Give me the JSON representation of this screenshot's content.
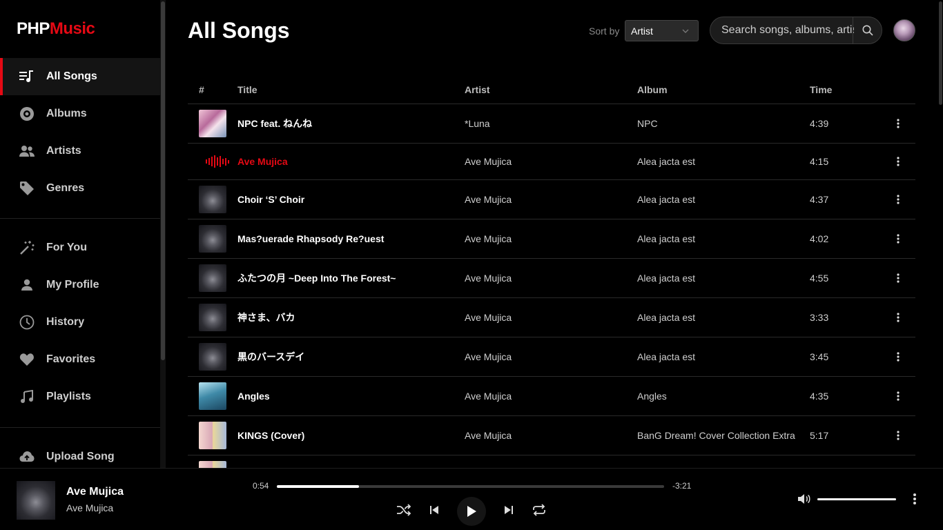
{
  "logo": {
    "part1": "PHP",
    "part2": "Music"
  },
  "sidebar": {
    "group1": [
      {
        "label": "All Songs",
        "icon": "song-list-icon",
        "active": true
      },
      {
        "label": "Albums",
        "icon": "disc-icon"
      },
      {
        "label": "Artists",
        "icon": "users-icon"
      },
      {
        "label": "Genres",
        "icon": "tag-icon"
      }
    ],
    "group2": [
      {
        "label": "For You",
        "icon": "magic-wand-icon"
      },
      {
        "label": "My Profile",
        "icon": "user-icon"
      },
      {
        "label": "History",
        "icon": "clock-icon"
      },
      {
        "label": "Favorites",
        "icon": "heart-icon"
      },
      {
        "label": "Playlists",
        "icon": "music-note-icon"
      }
    ],
    "group3": [
      {
        "label": "Upload Song",
        "icon": "cloud-upload-icon"
      }
    ]
  },
  "header": {
    "title": "All Songs",
    "sort_label": "Sort by",
    "sort_value": "Artist",
    "search_placeholder": "Search songs, albums, artists"
  },
  "table": {
    "headers": {
      "num": "#",
      "title": "Title",
      "artist": "Artist",
      "album": "Album",
      "time": "Time"
    },
    "rows": [
      {
        "title": "NPC feat. ねんね",
        "artist": "*Luna",
        "album": "NPC",
        "time": "4:39",
        "art": "npc"
      },
      {
        "title": "Ave Mujica",
        "artist": "Ave Mujica",
        "album": "Alea jacta est",
        "time": "4:15",
        "art": "ave",
        "playing": true
      },
      {
        "title": "Choir ‘S’ Choir",
        "artist": "Ave Mujica",
        "album": "Alea jacta est",
        "time": "4:37",
        "art": "ave"
      },
      {
        "title": "Mas?uerade Rhapsody Re?uest",
        "artist": "Ave Mujica",
        "album": "Alea jacta est",
        "time": "4:02",
        "art": "ave"
      },
      {
        "title": "ふたつの月 ~Deep Into The Forest~",
        "artist": "Ave Mujica",
        "album": "Alea jacta est",
        "time": "4:55",
        "art": "ave"
      },
      {
        "title": "神さま、バカ",
        "artist": "Ave Mujica",
        "album": "Alea jacta est",
        "time": "3:33",
        "art": "ave"
      },
      {
        "title": "黒のバースデイ",
        "artist": "Ave Mujica",
        "album": "Alea jacta est",
        "time": "3:45",
        "art": "ave"
      },
      {
        "title": "Angles",
        "artist": "Ave Mujica",
        "album": "Angles",
        "time": "4:35",
        "art": "angles"
      },
      {
        "title": "KINGS (Cover)",
        "artist": "Ave Mujica",
        "album": "BanG Dream! Cover Collection Extra",
        "time": "5:17",
        "art": "kings"
      },
      {
        "title": "",
        "artist": "",
        "album": "",
        "time": "",
        "art": "kings"
      }
    ]
  },
  "player": {
    "title": "Ave Mujica",
    "artist": "Ave Mujica",
    "current_time": "0:54",
    "remaining_time": "-3:21",
    "progress": 0.212,
    "volume": 1.0
  },
  "colors": {
    "accent": "#e50914",
    "background": "#000000"
  }
}
